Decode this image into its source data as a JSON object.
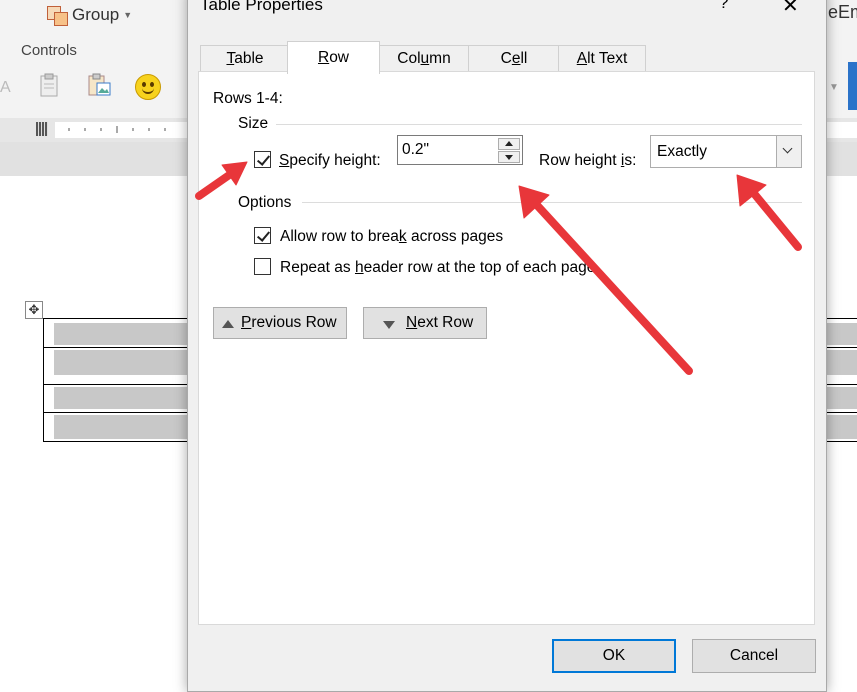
{
  "ribbon": {
    "group_label": "Group",
    "controls_label": "Controls",
    "right_cut_text": "eEm"
  },
  "dialog": {
    "title": "Table Properties",
    "help": "?",
    "close": "✕",
    "tabs": [
      {
        "label_u": "T",
        "label_rest": "able",
        "active": false
      },
      {
        "label_u": "R",
        "label_rest": "ow",
        "active": true
      },
      {
        "label_pre": "Col",
        "label_u": "u",
        "label_rest": "mn",
        "active": false
      },
      {
        "label_pre": "C",
        "label_u": "e",
        "label_rest": "ll",
        "active": false
      },
      {
        "label_u": "A",
        "label_rest": "lt Text",
        "active": false
      }
    ],
    "rows_label": "Rows 1-4:",
    "size_section": "Size",
    "specify_height": {
      "pre": "",
      "u": "S",
      "rest": "pecify height:",
      "checked": true
    },
    "height_value": "0.2\"",
    "row_height_is": {
      "pre": "Row height ",
      "u": "i",
      "rest": "s:"
    },
    "row_height_mode": "Exactly",
    "options_section": "Options",
    "allow_break": {
      "pre": "Allow row to brea",
      "u": "k",
      "rest": " across pages",
      "checked": true
    },
    "repeat_header": {
      "pre": "Repeat as ",
      "u": "h",
      "rest": "eader row at the top of each page",
      "checked": false
    },
    "prev_row": {
      "u": "P",
      "rest": "revious Row"
    },
    "next_row": {
      "u": "N",
      "rest": "ext Row"
    },
    "ok": "OK",
    "cancel": "Cancel"
  },
  "colors": {
    "annotation_arrow": "#e8363a",
    "focus_blue": "#0078d7"
  }
}
